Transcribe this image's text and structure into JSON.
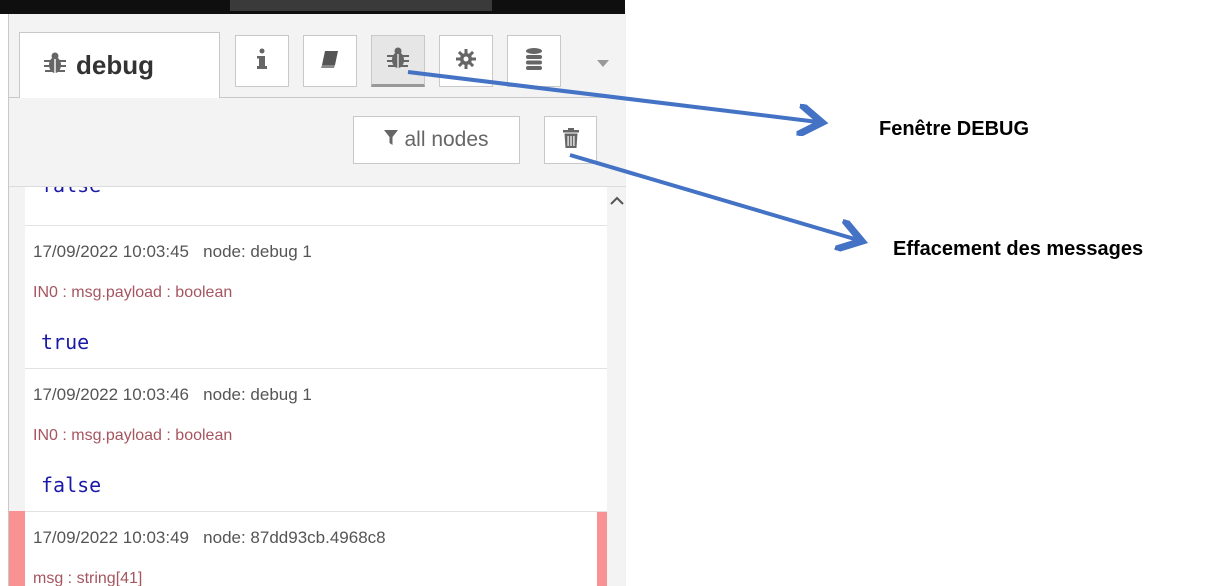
{
  "panel": {
    "tab_label": "debug",
    "tabs": [
      {
        "name": "info",
        "icon": "info-icon"
      },
      {
        "name": "help",
        "icon": "book-icon"
      },
      {
        "name": "debug",
        "icon": "bug-icon",
        "selected": true
      },
      {
        "name": "config",
        "icon": "gear-icon"
      },
      {
        "name": "context",
        "icon": "database-icon"
      }
    ]
  },
  "toolbar": {
    "filter_label": "all nodes",
    "clear_icon": "trash-icon"
  },
  "messages": {
    "partial_value": "false",
    "items": [
      {
        "timestamp": "17/09/2022 10:03:45",
        "node": "node: debug 1",
        "topic": "IN0 : msg.payload : boolean",
        "value": "true",
        "error": false
      },
      {
        "timestamp": "17/09/2022 10:03:46",
        "node": "node: debug 1",
        "topic": "IN0 : msg.payload : boolean",
        "value": "false",
        "error": false
      },
      {
        "timestamp": "17/09/2022 10:03:49",
        "node": "node: 87dd93cb.4968c8",
        "topic": "msg : string[41]",
        "value": "",
        "error": true
      }
    ]
  },
  "annotations": {
    "debug_window": "Fenêtre DEBUG",
    "clear_messages": "Effacement des messages"
  },
  "colors": {
    "arrow": "#4472c4",
    "error_bar": "#f99393",
    "topic_text": "#a6555f",
    "value_text": "#1a1aa6"
  }
}
